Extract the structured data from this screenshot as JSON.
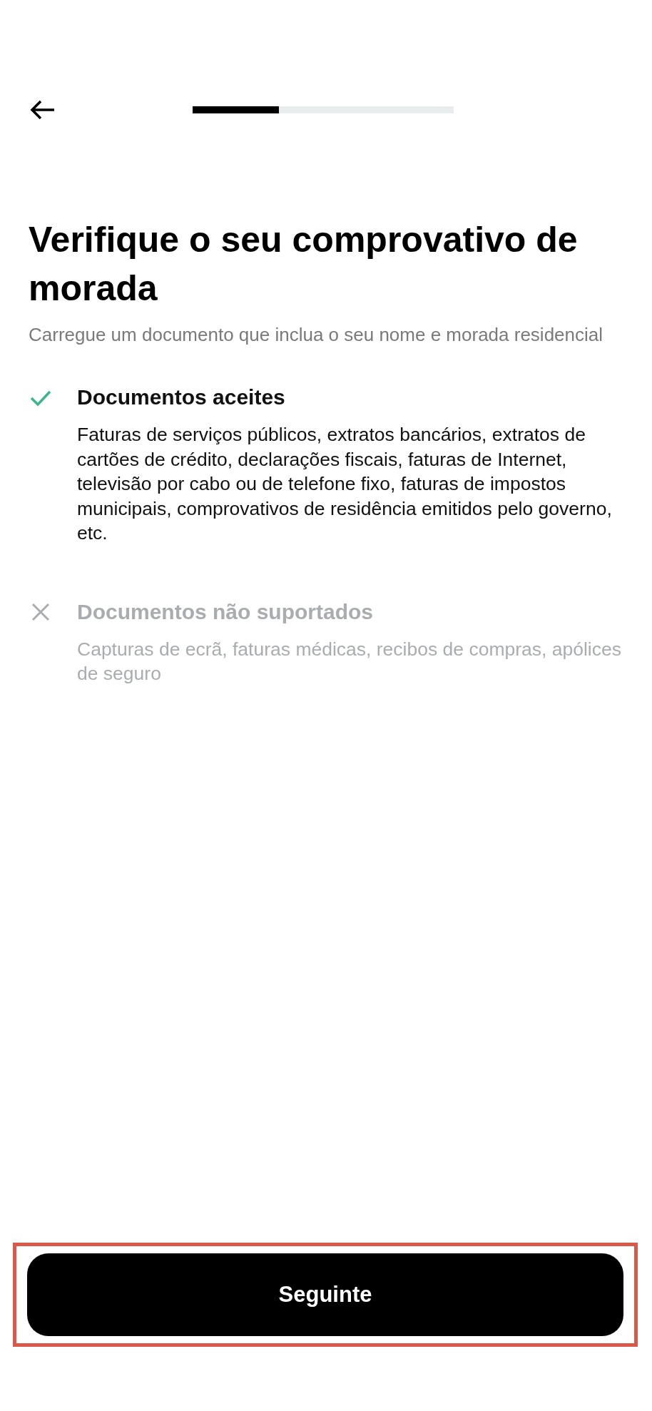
{
  "header": {
    "progress": {
      "level": 0.33
    }
  },
  "title": "Verifique o seu comprovativo de morada",
  "subtitle": "Carregue um documento que inclua o seu nome e morada residencial",
  "documents": [
    {
      "kind": "accepted",
      "heading": "Documentos aceites",
      "text": "Faturas de serviços públicos, extratos bancários, extratos de cartões de crédito, declarações fiscais, faturas de Internet, televisão por cabo ou de telefone fixo, faturas de impostos municipais, comprovativos de residência emitidos pelo governo, etc."
    },
    {
      "kind": "rejected",
      "heading": "Documentos não suportados",
      "text": "Capturas de ecrã, faturas médicas, recibos de compras, apólices de seguro"
    }
  ],
  "button": {
    "label": "Seguinte"
  }
}
